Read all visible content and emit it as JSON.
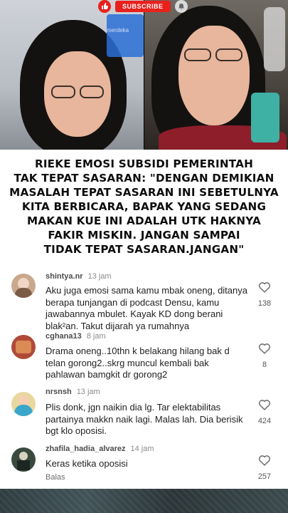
{
  "overlay": {
    "subscribe_label": "SUBSCRIBE",
    "watermark": "merdeka"
  },
  "headline": {
    "lines": [
      "RIEKE EMOSI SUBSIDI PEMERINTAH",
      "TAK TEPAT SASARAN: \"DENGAN DEMIKIAN",
      "MASALAH TEPAT SASARAN INI SEBETULNYA",
      "KITA BERBICARA, BAPAK YANG SEDANG",
      "MAKAN KUE INI ADALAH UTK HAKNYA",
      "FAKIR MISKIN. JANGAN SAMPAI",
      "TIDAK TEPAT SASARAN.JANGAN\""
    ]
  },
  "comments": [
    {
      "username": "shintya.nr",
      "time": "13 jam",
      "text": "Aku juga emosi sama kamu mbak oneng, ditanya berapa tunjangan di podcast Densu, kamu jawabannya mbulet. Kayak KD dong berani blak²an. Takut dijarah ya rumahnya",
      "likes": "138",
      "avatar_color": "#c9a88e"
    },
    {
      "username": "cghana13",
      "time": "8 jam",
      "text": "Drama oneng..10thn k belakang hilang bak d telan gorong2..skrg muncul kembali bak pahlawan bamgkit dr gorong2",
      "likes": "8",
      "avatar_color": "#b04a38"
    },
    {
      "username": "nrsnsh",
      "time": "13 jam",
      "text": "Plis donk, jgn naikin dia lg. Tar elektabilitas partainya makkn naik lagi. Malas lah. Dia berisik bgt klo oposisi.",
      "likes": "424",
      "avatar_color": "#e9d7a0"
    },
    {
      "username": "zhafila_hadia_alvarez",
      "time": "14 jam",
      "text": "Keras ketika oposisi",
      "likes": "257",
      "reply_label": "Balas",
      "avatar_color": "#3b4a3f"
    }
  ],
  "colors": {
    "accent": "#e8211c",
    "headline_bg": "#ffffff",
    "username": "#4c4c4c"
  }
}
